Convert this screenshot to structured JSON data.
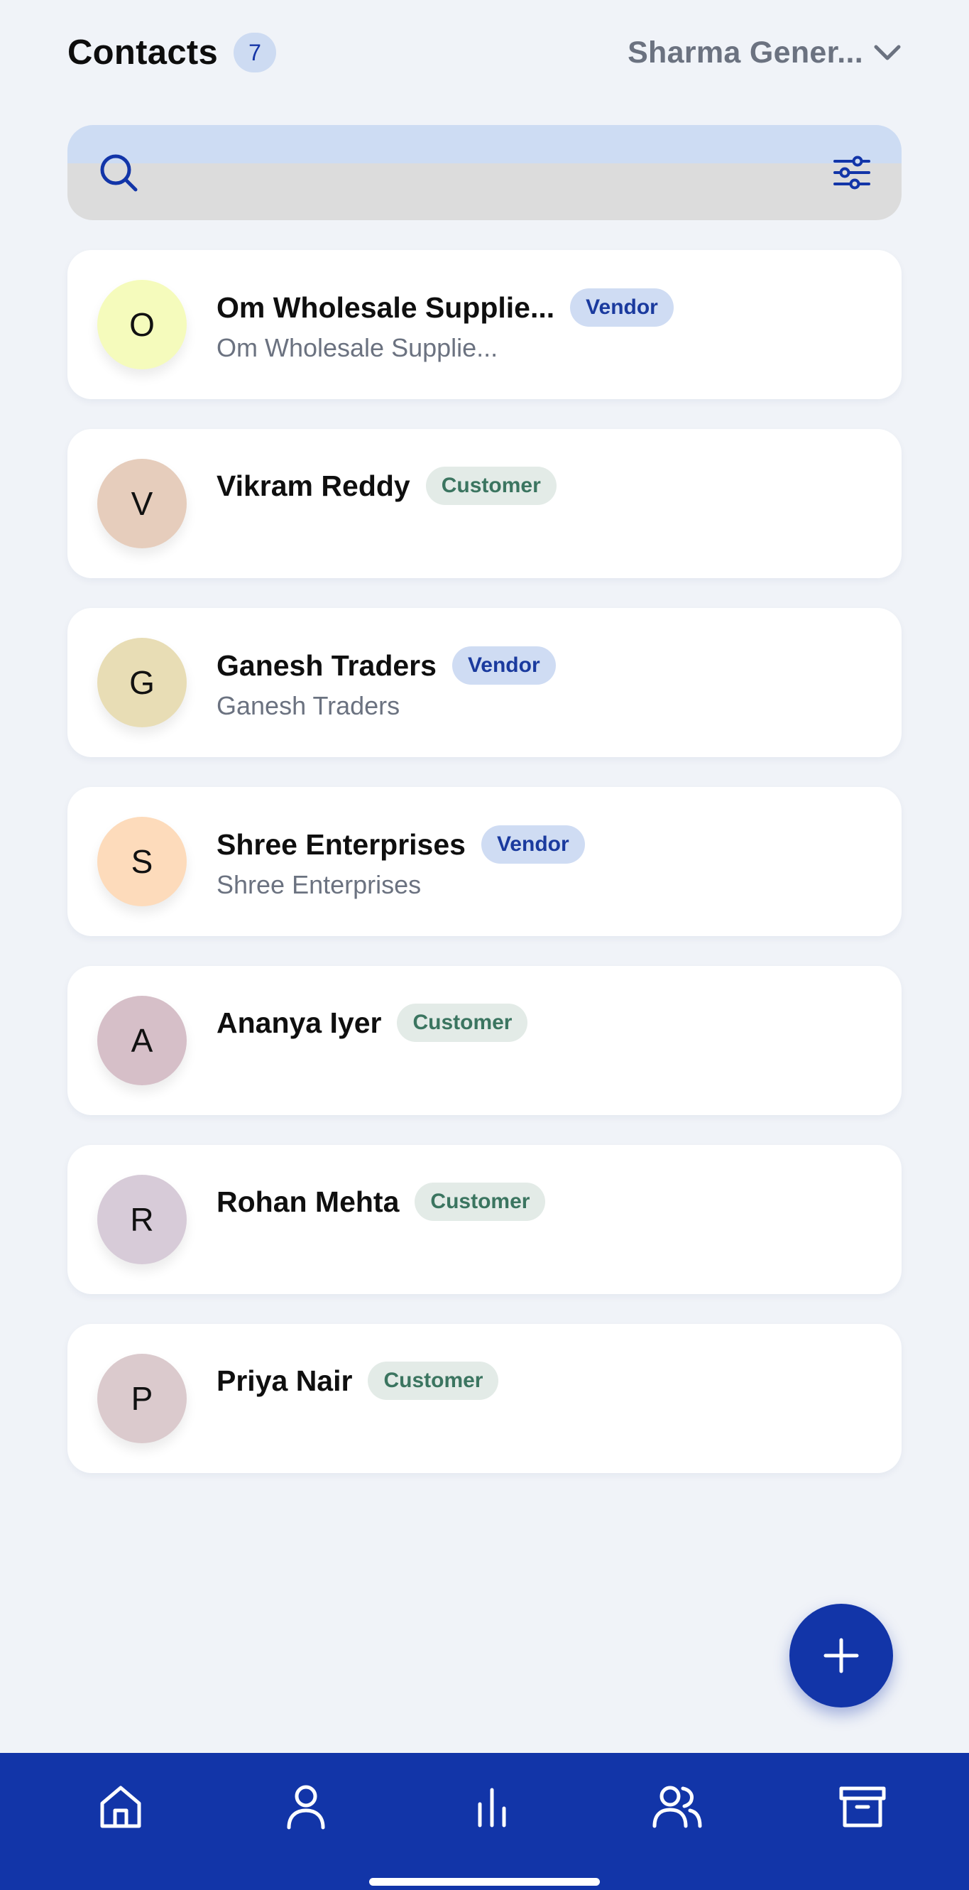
{
  "header": {
    "title": "Contacts",
    "count": "7",
    "business_name": "Sharma Gener..."
  },
  "search": {
    "placeholder": "",
    "value": ""
  },
  "contacts": [
    {
      "initial": "O",
      "name": "Om Wholesale Supplie...",
      "tag": "Vendor",
      "subtitle": "Om Wholesale Supplie...",
      "avatar_color": "#f5fbbc"
    },
    {
      "initial": "V",
      "name": "Vikram Reddy",
      "tag": "Customer",
      "subtitle": "",
      "avatar_color": "#e6cdbc"
    },
    {
      "initial": "G",
      "name": "Ganesh Traders",
      "tag": "Vendor",
      "subtitle": "Ganesh Traders",
      "avatar_color": "#e8ddb5"
    },
    {
      "initial": "S",
      "name": "Shree Enterprises",
      "tag": "Vendor",
      "subtitle": "Shree Enterprises",
      "avatar_color": "#fddbbb"
    },
    {
      "initial": "A",
      "name": "Ananya Iyer",
      "tag": "Customer",
      "subtitle": "",
      "avatar_color": "#d6bfc8"
    },
    {
      "initial": "R",
      "name": "Rohan Mehta",
      "tag": "Customer",
      "subtitle": "",
      "avatar_color": "#d7cbd8"
    },
    {
      "initial": "P",
      "name": "Priya Nair",
      "tag": "Customer",
      "subtitle": "",
      "avatar_color": "#dbcacd"
    }
  ],
  "colors": {
    "primary": "#1235a8",
    "background": "#f0f3f8",
    "vendor_tag_bg": "#cfdcf3",
    "customer_tag_bg": "#e3ebe7"
  },
  "nav": {
    "items": [
      "home-icon",
      "profile-icon",
      "reports-icon",
      "contacts-icon",
      "archive-icon"
    ]
  }
}
